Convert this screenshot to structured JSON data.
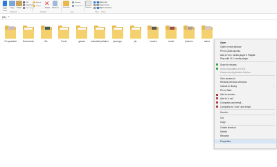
{
  "ribbon": {
    "clipboard_caption": "Clipboard",
    "organize_caption": "Organize",
    "new_caption": "New",
    "open_caption": "Open",
    "select_caption": "Select",
    "buttons": {
      "pin": "Pin to Quick access",
      "copy": "Copy",
      "paste": "Paste",
      "cut": "Cut",
      "copy_path": "Copy path",
      "paste_shortcut": "Paste shortcut",
      "move_to": "Move to",
      "copy_to": "Copy to",
      "delete": "Delete",
      "rename": "Rename",
      "new_folder": "New folder",
      "new_item": "New item",
      "easy_access": "Easy access",
      "properties": "Properties",
      "open": "Open",
      "edit": "Edit",
      "history": "History",
      "select_all": "Select all",
      "select_none": "Select none",
      "invert_selection": "Invert selection"
    },
    "colors": {
      "accent": "#2b79d8",
      "danger": "#d83b3b",
      "folder": "#e8b94a"
    }
  },
  "address": {
    "path": "(B:)"
  },
  "folders": [
    {
      "name": "C's practical",
      "thumb": true,
      "thumb_color": "#c9b7c6"
    },
    {
      "name": "Documents",
      "thumb": false
    },
    {
      "name": "file",
      "thumb": true,
      "thumb_color": "#3e5a4a"
    },
    {
      "name": "Fonts",
      "thumb": false
    },
    {
      "name": "games",
      "thumb": false
    },
    {
      "name": "industrial pollution",
      "thumb": false
    },
    {
      "name": "java app",
      "thumb": false
    },
    {
      "name": "jts",
      "thumb": false
    },
    {
      "name": "movies",
      "thumb": true,
      "thumb_color": "#5e5546"
    },
    {
      "name": "music",
      "thumb": true,
      "thumb_color": "#a24d3c"
    },
    {
      "name": "pictures",
      "thumb": true,
      "thumb_color": "#b79a88"
    },
    {
      "name": "sabot",
      "thumb": true,
      "thumb_color": "#d8c6c6"
    }
  ],
  "context_menu": {
    "items": [
      {
        "label": "Open",
        "bold": true,
        "icon": null
      },
      {
        "label": "Open in new window",
        "icon": null
      },
      {
        "label": "Pin to Quick access",
        "icon": null
      },
      {
        "label": "Add to VLC media player's Playlist",
        "icon": null
      },
      {
        "label": "Play with VLC media player",
        "icon": null
      },
      {
        "sep": true
      },
      {
        "label": "Scan for viruses",
        "icon": "shield-icon",
        "icon_color": "#3aa34a"
      },
      {
        "label": "Check reputation in KSN",
        "icon": "ksn-icon",
        "icon_color": "#3aa34a",
        "dim": true
      },
      {
        "label": "Kaspersky Application Advisor",
        "icon": null,
        "dim": true
      },
      {
        "sep": true
      },
      {
        "label": "Give access to",
        "arrow": true,
        "icon": null
      },
      {
        "label": "Restore previous versions",
        "icon": null
      },
      {
        "label": "Include in library",
        "arrow": true,
        "icon": null
      },
      {
        "label": "Pin to Start",
        "icon": null
      },
      {
        "label": "Add to archive...",
        "icon": "winrar-icon",
        "icon_color": "#b03a3a"
      },
      {
        "label": "Add to \"s.rar\"",
        "icon": "winrar-icon",
        "icon_color": "#b03a3a"
      },
      {
        "label": "Compress and email...",
        "icon": "winrar-icon",
        "icon_color": "#b03a3a"
      },
      {
        "label": "Compress to \"s.rar\" and email",
        "icon": "winrar-icon",
        "icon_color": "#b03a3a"
      },
      {
        "sep": true
      },
      {
        "label": "Send to",
        "arrow": true,
        "icon": null
      },
      {
        "sep": true
      },
      {
        "label": "Cut",
        "icon": null
      },
      {
        "label": "Copy",
        "icon": null
      },
      {
        "sep": true
      },
      {
        "label": "Create shortcut",
        "icon": null
      },
      {
        "label": "Delete",
        "icon": null
      },
      {
        "label": "Rename",
        "icon": null
      },
      {
        "sep": true
      },
      {
        "label": "Properties",
        "icon": null,
        "highlight": true
      }
    ]
  }
}
